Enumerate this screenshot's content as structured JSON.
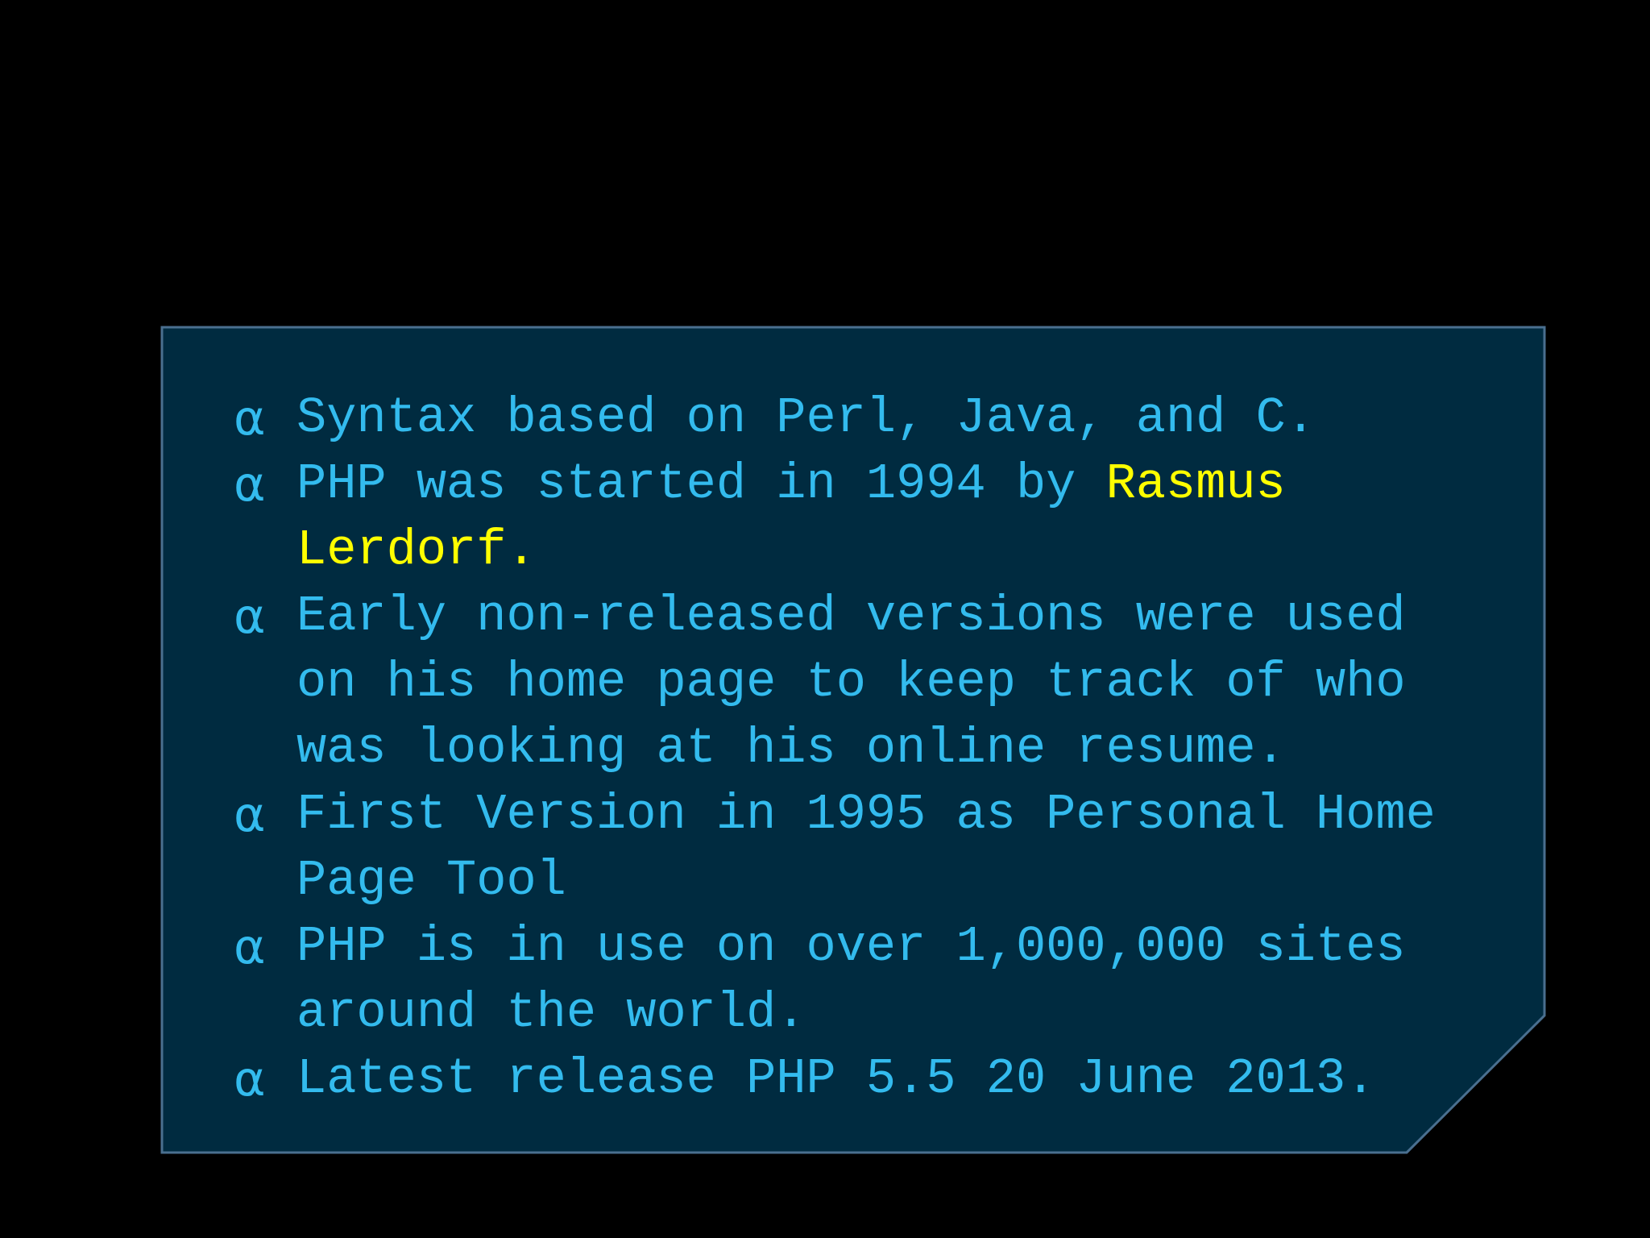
{
  "slide": {
    "bullet_symbol": "α",
    "panel_fill": "#002b40",
    "panel_border": "#4a6f8f",
    "text_color": "#33bbee",
    "highlight_color": "#ffff00",
    "bullets": [
      {
        "text": "Syntax based on Perl, Java, and C."
      },
      {
        "before": "PHP was started in 1994 by ",
        "highlight": "Rasmus Lerdorf."
      },
      {
        "text": "Early non-released versions were used on his home page to keep track of who was looking at his online resume."
      },
      {
        "text": "First Version in 1995 as Personal Home Page Tool"
      },
      {
        "text": "PHP is in use on over 1,000,000 sites around the world."
      },
      {
        "text": "Latest release PHP 5.5 20 June 2013."
      }
    ]
  }
}
